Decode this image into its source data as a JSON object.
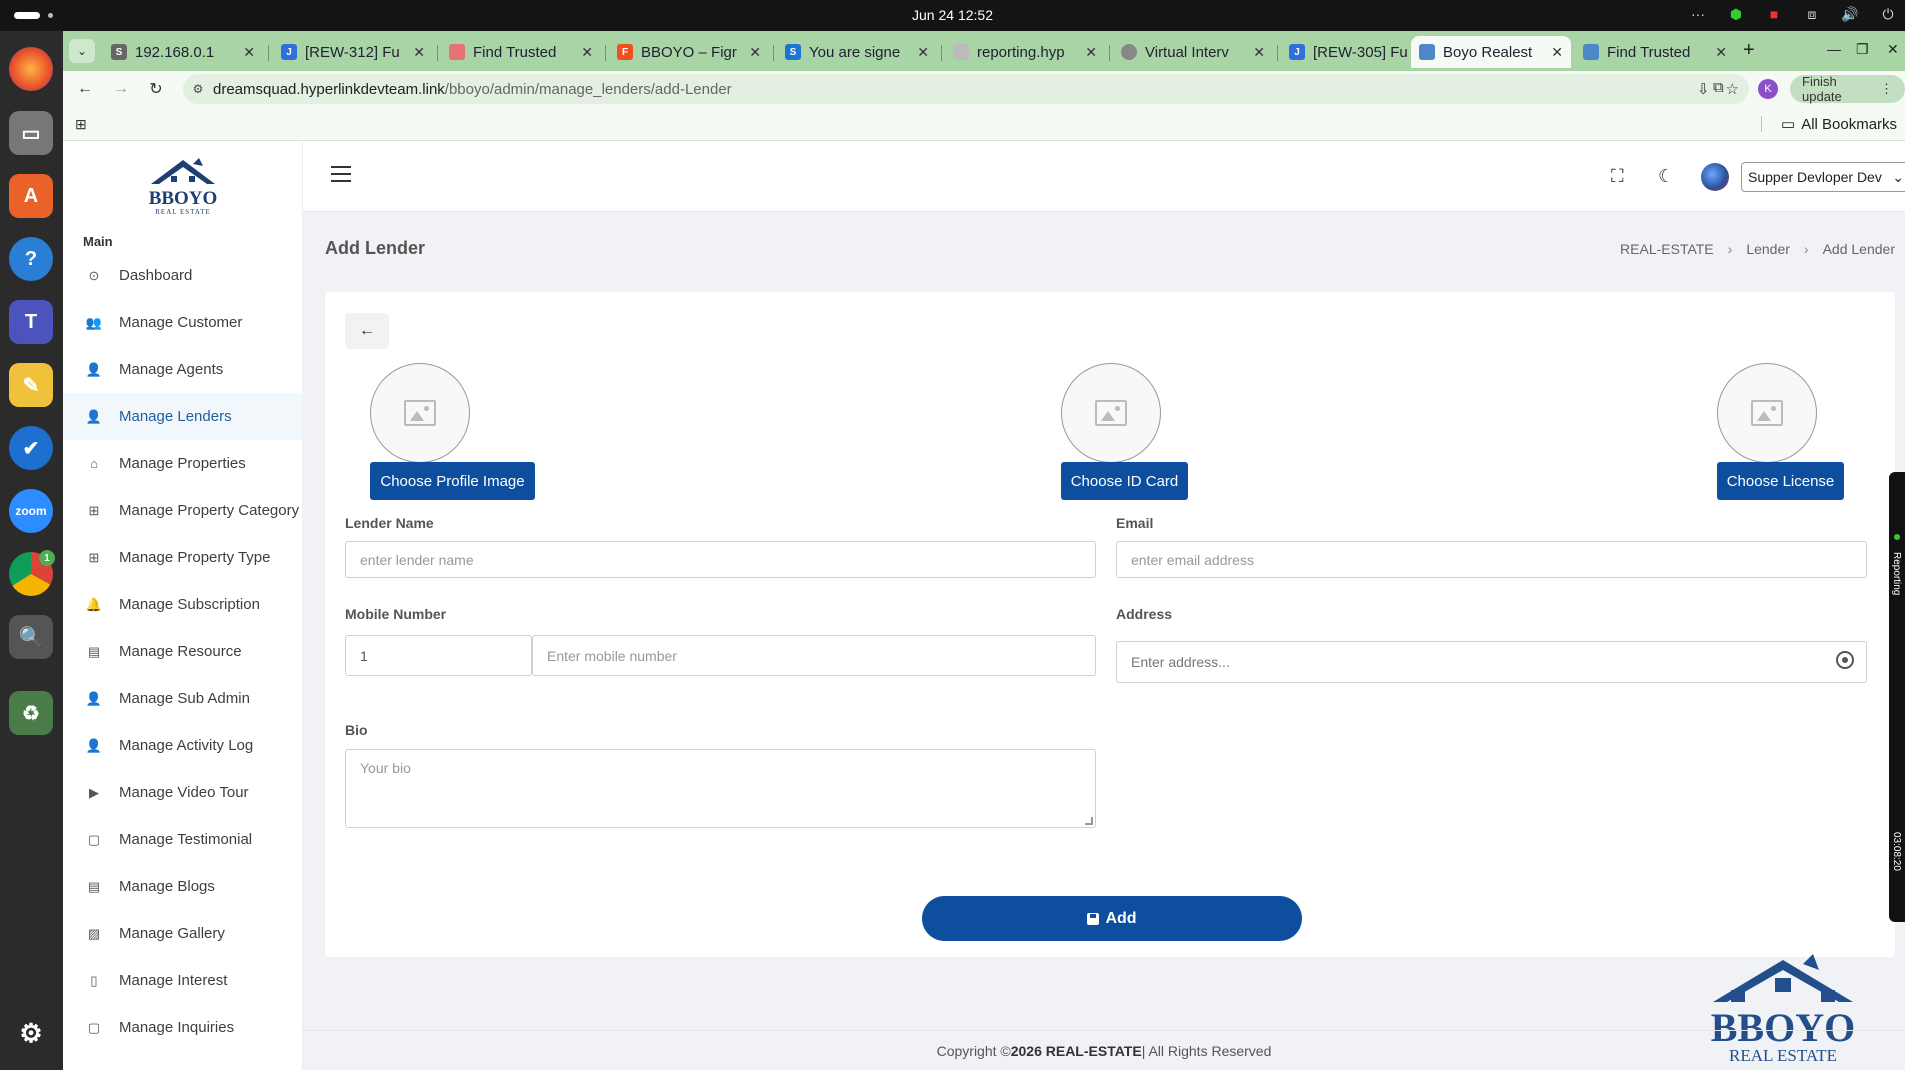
{
  "os": {
    "clock": "Jun 24  12:52"
  },
  "browser": {
    "tabs": [
      {
        "title": "192.168.0.1",
        "fav": "S"
      },
      {
        "title": "[REW-312] Fu",
        "fav": "J"
      },
      {
        "title": "Find Trusted",
        "fav": ""
      },
      {
        "title": "BBOYO – Figr",
        "fav": "F"
      },
      {
        "title": "You are signe",
        "fav": "S"
      },
      {
        "title": "reporting.hyp",
        "fav": ""
      },
      {
        "title": "Virtual Interv",
        "fav": ""
      },
      {
        "title": "[REW-305] Fu",
        "fav": "J"
      },
      {
        "title": "Boyo Realest",
        "fav": ""
      },
      {
        "title": "Find Trusted",
        "fav": ""
      }
    ],
    "url_host": "dreamsquad.hyperlinkdevteam.link",
    "url_path": "/bboyo/admin/manage_lenders/add-Lender",
    "profile_initial": "K",
    "finish_update": "Finish update",
    "all_bookmarks": "All Bookmarks"
  },
  "logo": {
    "name": "BBOYO",
    "sub": "REAL ESTATE"
  },
  "sidebar": {
    "heading": "Main",
    "items": [
      {
        "label": "Dashboard",
        "icon": "⊙"
      },
      {
        "label": "Manage Customer",
        "icon": "👥"
      },
      {
        "label": "Manage Agents",
        "icon": "👤"
      },
      {
        "label": "Manage Lenders",
        "icon": "👤"
      },
      {
        "label": "Manage Properties",
        "icon": "⌂"
      },
      {
        "label": "Manage Property Category",
        "icon": "⊞"
      },
      {
        "label": "Manage Property Type",
        "icon": "⊞"
      },
      {
        "label": "Manage Subscription",
        "icon": "🔔"
      },
      {
        "label": "Manage Resource",
        "icon": "▤"
      },
      {
        "label": "Manage Sub Admin",
        "icon": "👤"
      },
      {
        "label": "Manage Activity Log",
        "icon": "👤"
      },
      {
        "label": "Manage Video Tour",
        "icon": "▶"
      },
      {
        "label": "Manage Testimonial",
        "icon": "▢"
      },
      {
        "label": "Manage Blogs",
        "icon": "▤"
      },
      {
        "label": "Manage Gallery",
        "icon": "▨"
      },
      {
        "label": "Manage Interest",
        "icon": "▯"
      },
      {
        "label": "Manage Inquiries",
        "icon": "▢"
      }
    ]
  },
  "header": {
    "user": "Supper Devloper Dev"
  },
  "page": {
    "title": "Add Lender",
    "breadcrumb": [
      "REAL-ESTATE",
      "Lender",
      "Add Lender"
    ]
  },
  "form": {
    "choose_profile": "Choose Profile Image",
    "choose_id": "Choose ID Card",
    "choose_license": "Choose License",
    "lender_name_label": "Lender Name",
    "lender_name_placeholder": "enter lender name",
    "email_label": "Email",
    "email_placeholder": "enter email address",
    "mobile_label": "Mobile Number",
    "country_code": "1",
    "mobile_placeholder": "Enter mobile number",
    "address_label": "Address",
    "address_placeholder": "Enter address...",
    "bio_label": "Bio",
    "bio_placeholder": "Your bio",
    "add_label": "Add"
  },
  "watermark": {
    "name": "BBOYO",
    "sub": "REAL ESTATE"
  },
  "footer": {
    "prefix": "Copyright © ",
    "strong": "2026 REAL-ESTATE",
    "suffix": " | All Rights Reserved"
  },
  "side_widget": {
    "label": "Reporting",
    "time": "03:08:20"
  },
  "colors": {
    "primary": "#0d4f9e",
    "tabstrip": "#a8d4a6"
  }
}
